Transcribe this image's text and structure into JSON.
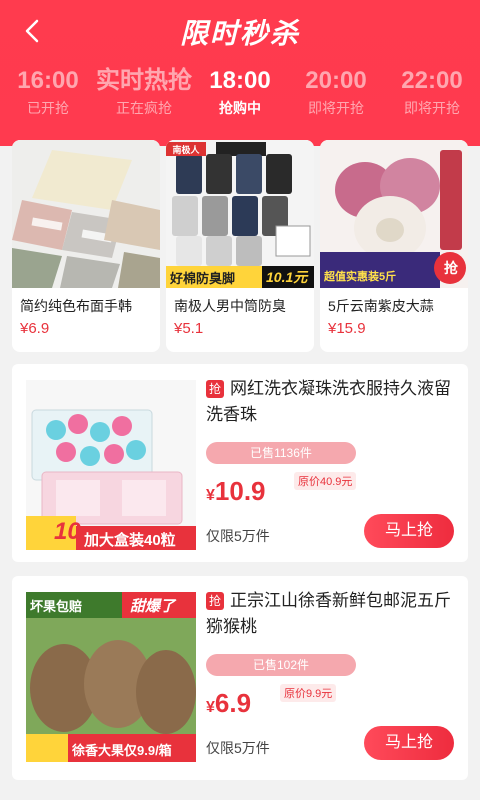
{
  "header": {
    "title": "限时秒杀"
  },
  "slots": [
    {
      "time": "16:00",
      "status": "已开抢"
    },
    {
      "time": "实时热抢",
      "status": "正在疯抢"
    },
    {
      "time": "18:00",
      "status": "抢购中"
    },
    {
      "time": "20:00",
      "status": "即将开抢"
    },
    {
      "time": "22:00",
      "status": "即将开抢"
    }
  ],
  "top_products": [
    {
      "name": "简约纯色布面手韩",
      "price": "¥6.9"
    },
    {
      "name": "南极人男中筒防臭",
      "price": "¥5.1",
      "banner": "好棉防臭脚",
      "badge": "10.1元",
      "brand": "南极人"
    },
    {
      "name": "5斤云南紫皮大蒜",
      "price": "¥15.9",
      "banner": "超值实惠装5斤",
      "tag": "抢"
    }
  ],
  "list_products": [
    {
      "tag": "抢",
      "name": "网红洗衣凝珠洗衣服持久液留洗香珠",
      "sold": "已售1136件",
      "yen": "¥",
      "price": "10.9",
      "orig": "原价40.9元",
      "limit": "仅限5万件",
      "buy": "马上抢",
      "promo": "加大盒装40粒",
      "promo_amount": "10"
    },
    {
      "tag": "抢",
      "name": "正宗江山徐香新鲜包邮泥五斤猕猴桃",
      "sold": "已售102件",
      "yen": "¥",
      "price": "6.9",
      "orig": "原价9.9元",
      "limit": "仅限5万件",
      "buy": "马上抢",
      "promo_top_left": "坏果包赔",
      "promo_top_right": "甜爆了",
      "promo_bottom": "徐香大果仅9.9/箱"
    }
  ],
  "colors": {
    "accent": "#e8323c",
    "hero": "#ff3b4e"
  }
}
